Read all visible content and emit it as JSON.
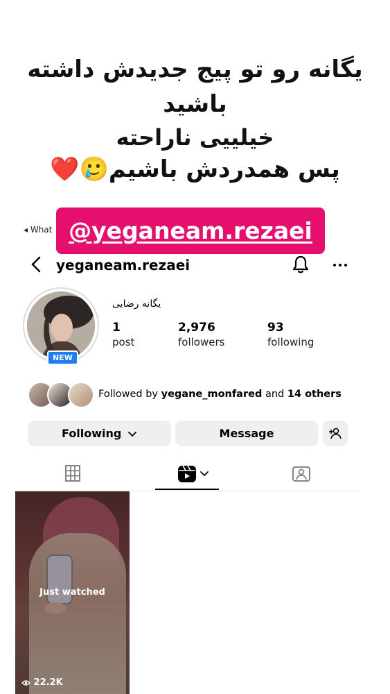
{
  "caption": {
    "line1": "یگانه رو تو پیج جدیدش داشته",
    "line2": "باشید",
    "line3": "خیلییی ناراحته",
    "line4": "پس همدردش باشیم🥲❤️"
  },
  "mention": "@yeganeam.rezaei",
  "back_link": "◂ What",
  "profile": {
    "username": "yeganeam.rezaei",
    "display_name": "یگانه رضایی",
    "badge": "NEW",
    "stats": [
      {
        "value": "1",
        "label": "post"
      },
      {
        "value": "2,976",
        "label": "followers"
      },
      {
        "value": "93",
        "label": "following"
      }
    ]
  },
  "followed_by": {
    "prefix": "Followed by",
    "user": "yegane_monfared",
    "mid": "and",
    "others": "14 others"
  },
  "buttons": {
    "following": "Following",
    "message": "Message"
  },
  "reel": {
    "overlay": "Just watched",
    "views": "22.2K"
  },
  "colors": {
    "mention_bg": "#e5106e",
    "badge_blue": "#1d7df2",
    "button_bg": "#efeff0"
  }
}
